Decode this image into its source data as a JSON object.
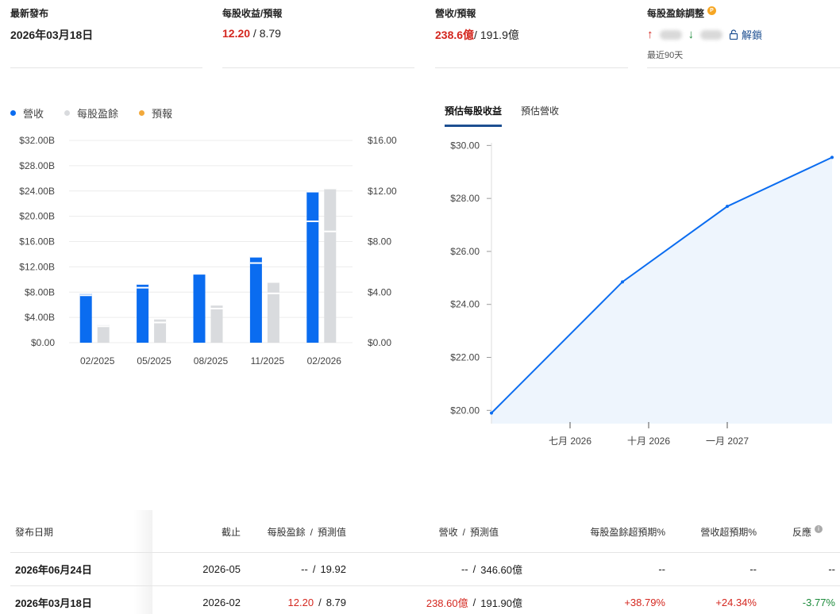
{
  "summary": {
    "latest_release": {
      "label": "最新發布",
      "value": "2026年03月18日"
    },
    "eps": {
      "label": "每股收益/預報",
      "actual": "12.20",
      "separator": " / ",
      "forecast": "8.79"
    },
    "revenue": {
      "label": "營收/預報",
      "actual": "238.6億",
      "separator": "/ ",
      "forecast": "191.9億"
    },
    "eps_revisions": {
      "label": "每股盈餘調整",
      "badge": "P",
      "unlock_label": "解鎖",
      "period": "最近90天"
    }
  },
  "legend": [
    {
      "label": "營收",
      "color": "#0a6cf0"
    },
    {
      "label": "每股盈餘",
      "color": "#d9dbde"
    },
    {
      "label": "預報",
      "color": "#f2a93b"
    }
  ],
  "tabs": [
    {
      "label": "預估每股收益",
      "active": true
    },
    {
      "label": "預估營收",
      "active": false
    }
  ],
  "chart_data": [
    {
      "type": "bar",
      "categories": [
        "02/2025",
        "05/2025",
        "08/2025",
        "11/2025",
        "02/2026"
      ],
      "left_axis": {
        "ticks": [
          "$0.00",
          "$4.00B",
          "$8.00B",
          "$12.00B",
          "$16.00B",
          "$20.00B",
          "$24.00B",
          "$28.00B",
          "$32.00B"
        ],
        "ylim": [
          0,
          32
        ]
      },
      "right_axis": {
        "ticks": [
          "$0.00",
          "$4.00",
          "$8.00",
          "$12.00",
          "$16.00"
        ],
        "ylim": [
          0,
          16
        ]
      },
      "series": [
        {
          "name": "營收",
          "axis": "left",
          "color": "#0a6cf0",
          "values": [
            7.8,
            8.7,
            10.9,
            12.6,
            19.2
          ],
          "forecast": [
            7.5,
            9.3,
            11.0,
            13.6,
            23.9
          ]
        },
        {
          "name": "每股盈餘",
          "axis": "right",
          "color": "#d9dbde",
          "values": [
            1.45,
            1.6,
            2.7,
            3.9,
            8.8
          ],
          "forecast": [
            1.3,
            1.9,
            3.0,
            4.8,
            12.2
          ]
        }
      ],
      "grid": true
    },
    {
      "type": "area",
      "x": [
        "2026-04",
        "2026-09",
        "2027-01",
        "2027-05"
      ],
      "x_ticks": [
        "七月 2026",
        "十月 2026",
        "一月 2027"
      ],
      "values": [
        19.9,
        24.85,
        27.7,
        29.55
      ],
      "y_ticks": [
        "$20.00",
        "$22.00",
        "$24.00",
        "$26.00",
        "$28.00",
        "$30.00"
      ],
      "ylim": [
        19.5,
        30.4
      ],
      "color": "#0a6cf0",
      "fill": "#eef5fd"
    }
  ],
  "table": {
    "headers": {
      "date": "發布日期",
      "period_end": "截止",
      "eps_label": "每股盈餘",
      "forecast_label": "預測值",
      "revenue_label": "營收",
      "sep": "/",
      "eps_surprise": "每股盈餘超預期%",
      "revenue_surprise": "營收超預期%",
      "reaction": "反應"
    },
    "rows": [
      {
        "date": "2026年06月24日",
        "period_end": "2026-05",
        "eps": "--",
        "eps_forecast": "19.92",
        "revenue": "--",
        "revenue_forecast": "346.60億",
        "eps_surprise": "--",
        "revenue_surprise": "--",
        "reaction": "--"
      },
      {
        "date": "2026年03月18日",
        "period_end": "2026-02",
        "eps": "12.20",
        "eps_forecast": "8.79",
        "revenue": "238.60億",
        "revenue_forecast": "191.90億",
        "eps_surprise": "+38.79%",
        "revenue_surprise": "+24.34%",
        "reaction": "-3.77%"
      }
    ]
  }
}
